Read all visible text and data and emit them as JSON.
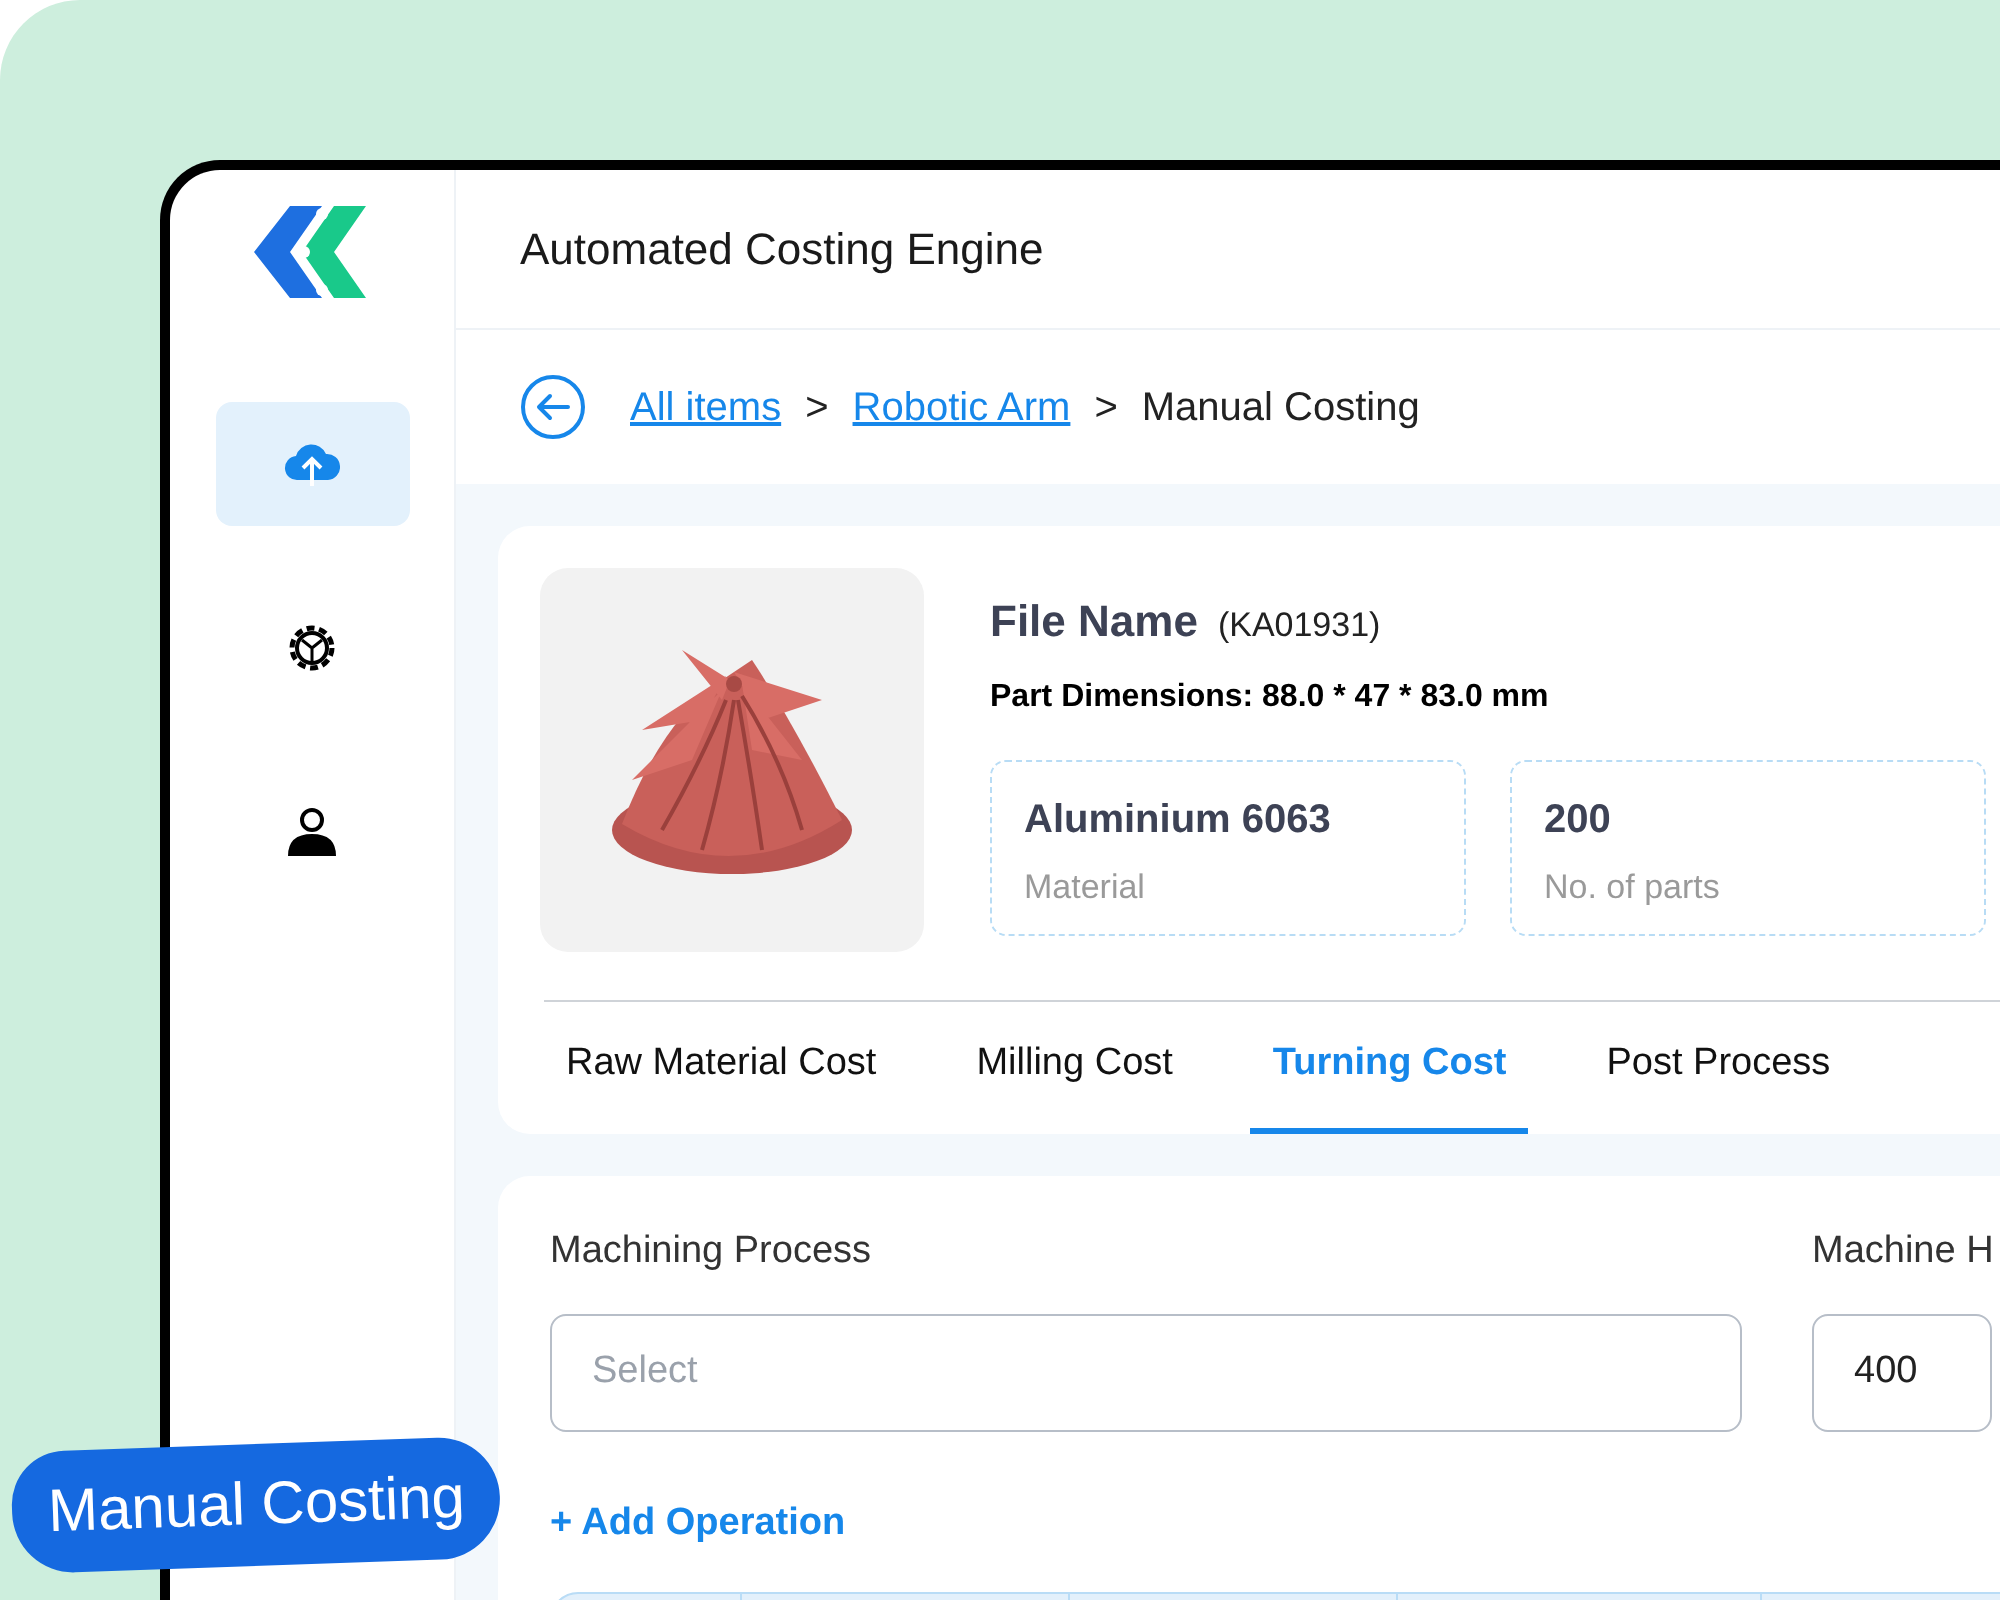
{
  "header": {
    "title": "Automated Costing Engine"
  },
  "sidebar": {
    "items": [
      {
        "kind": "upload",
        "selected": true
      },
      {
        "kind": "settings",
        "selected": false
      },
      {
        "kind": "user",
        "selected": false
      }
    ]
  },
  "breadcrumb": [
    {
      "kind": "link",
      "label": "All items"
    },
    {
      "kind": "separator",
      "label": ">"
    },
    {
      "kind": "link",
      "label": "Robotic Arm"
    },
    {
      "kind": "separator",
      "label": ">"
    },
    {
      "kind": "current",
      "label": "Manual Costing"
    }
  ],
  "part": {
    "file_label": "File Name",
    "file_id": "(KA01931)",
    "dimensions": "Part Dimensions: 88.0 * 47 * 83.0 mm",
    "stats": [
      {
        "value": "Aluminium 6063",
        "label": "Material"
      },
      {
        "value": "200",
        "label": "No. of parts"
      }
    ]
  },
  "tabs": [
    {
      "label": "Raw Material Cost",
      "selected": false
    },
    {
      "label": "Milling Cost",
      "selected": false
    },
    {
      "label": "Turning Cost",
      "selected": true
    },
    {
      "label": "Post Process",
      "selected": false
    }
  ],
  "form": {
    "fields": [
      {
        "label": "Machining Process",
        "placeholder": "Select"
      },
      {
        "label": "Machine H",
        "value": "400"
      }
    ],
    "add_operation": "+ Add Operation"
  },
  "badge": "Manual Costing"
}
